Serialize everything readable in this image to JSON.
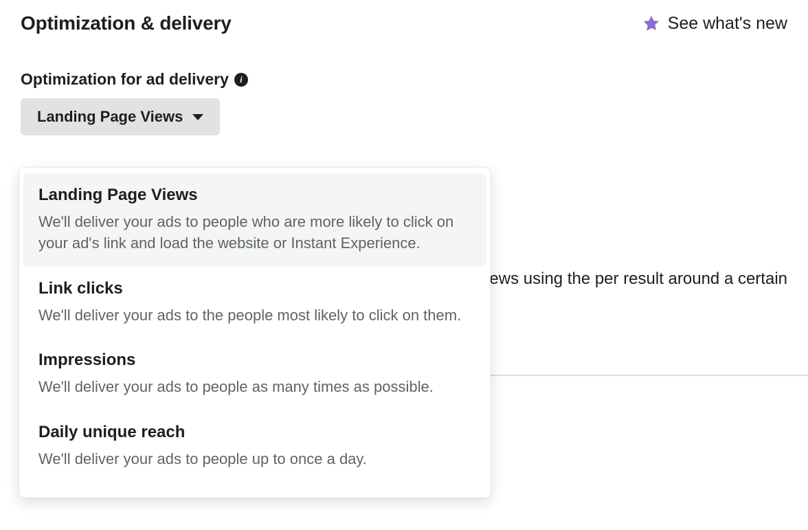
{
  "header": {
    "title": "Optimization & delivery",
    "whats_new_label": "See what's new"
  },
  "optimization": {
    "label": "Optimization for ad delivery",
    "selected": "Landing Page Views",
    "options": [
      {
        "title": "Landing Page Views",
        "desc": "We'll deliver your ads to people who are more likely to click on your ad's link and load the website or Instant Experience.",
        "highlighted": true
      },
      {
        "title": "Link clicks",
        "desc": "We'll deliver your ads to the people most likely to click on them.",
        "highlighted": false
      },
      {
        "title": "Impressions",
        "desc": "We'll deliver your ads to people as many times as possible.",
        "highlighted": false
      },
      {
        "title": "Daily unique reach",
        "desc": "We'll deliver your ads to people up to once a day.",
        "highlighted": false
      }
    ]
  },
  "background_hint": "ost landing page views using the per result around a certain"
}
